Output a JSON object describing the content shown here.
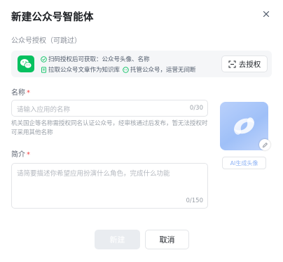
{
  "dialog": {
    "title": "新建公众号智能体",
    "close_icon": "close-icon"
  },
  "auth_section": {
    "label": "公众号授权（可跳过）",
    "line1_text": "扫码授权后可获取：公众号头像、名称",
    "line2_part1": "拉取公众号文章作为知识库",
    "line2_part2": "托管公众号，运营无间断",
    "authorize_button": "去授权",
    "icons": [
      "wechat-icon",
      "check-circle-icon",
      "document-icon",
      "robot-icon",
      "link-icon"
    ],
    "accent_color": "#07c160"
  },
  "name_field": {
    "label": "名称",
    "required_mark": "*",
    "placeholder": "请输入应用的名称",
    "counter": "0/30",
    "hint": "机关国企等名称需授权同名认证公众号，经审核通过后发布，暂无法授权时可采用其他名称"
  },
  "avatar": {
    "ai_button": "AI生成头像",
    "edit_icon": "pencil-icon"
  },
  "desc_field": {
    "label": "简介",
    "required_mark": "*",
    "placeholder": "请简要描述你希望应用扮演什么角色，完成什么功能",
    "counter": "0/150"
  },
  "footer": {
    "create_button": "新建",
    "cancel_button": "取消"
  }
}
